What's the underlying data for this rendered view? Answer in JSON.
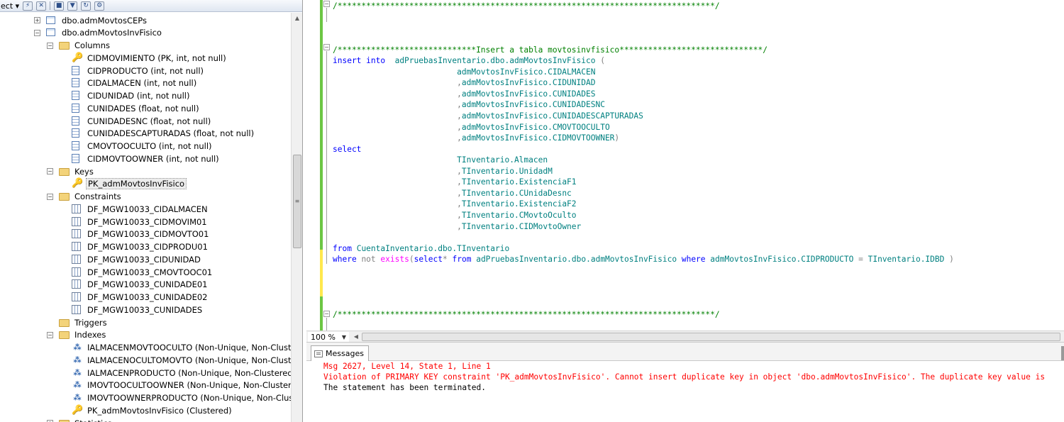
{
  "explorer": {
    "toolbar_label": "ect",
    "tree": [
      {
        "indent": 0,
        "expander": "+",
        "icon": "table",
        "label": "dbo.admMovtosCEPs"
      },
      {
        "indent": 0,
        "expander": "-",
        "icon": "table",
        "label": "dbo.admMovtosInvFisico"
      },
      {
        "indent": 1,
        "expander": "-",
        "icon": "folder",
        "label": "Columns"
      },
      {
        "indent": 2,
        "expander": "",
        "icon": "key",
        "label": "CIDMOVIMIENTO (PK, int, not null)"
      },
      {
        "indent": 2,
        "expander": "",
        "icon": "column",
        "label": "CIDPRODUCTO (int, not null)"
      },
      {
        "indent": 2,
        "expander": "",
        "icon": "column",
        "label": "CIDALMACEN (int, not null)"
      },
      {
        "indent": 2,
        "expander": "",
        "icon": "column",
        "label": "CIDUNIDAD (int, not null)"
      },
      {
        "indent": 2,
        "expander": "",
        "icon": "column",
        "label": "CUNIDADES (float, not null)"
      },
      {
        "indent": 2,
        "expander": "",
        "icon": "column",
        "label": "CUNIDADESNC (float, not null)"
      },
      {
        "indent": 2,
        "expander": "",
        "icon": "column",
        "label": "CUNIDADESCAPTURADAS (float, not null)"
      },
      {
        "indent": 2,
        "expander": "",
        "icon": "column",
        "label": "CMOVTOOCULTO (int, not null)"
      },
      {
        "indent": 2,
        "expander": "",
        "icon": "column",
        "label": "CIDMOVTOOWNER (int, not null)"
      },
      {
        "indent": 1,
        "expander": "-",
        "icon": "folder",
        "label": "Keys"
      },
      {
        "indent": 2,
        "expander": "",
        "icon": "key",
        "label": "PK_admMovtosInvFisico",
        "selected": true
      },
      {
        "indent": 1,
        "expander": "-",
        "icon": "folder",
        "label": "Constraints"
      },
      {
        "indent": 2,
        "expander": "",
        "icon": "constraint",
        "label": "DF_MGW10033_CIDALMACEN"
      },
      {
        "indent": 2,
        "expander": "",
        "icon": "constraint",
        "label": "DF_MGW10033_CIDMOVIM01"
      },
      {
        "indent": 2,
        "expander": "",
        "icon": "constraint",
        "label": "DF_MGW10033_CIDMOVTO01"
      },
      {
        "indent": 2,
        "expander": "",
        "icon": "constraint",
        "label": "DF_MGW10033_CIDPRODU01"
      },
      {
        "indent": 2,
        "expander": "",
        "icon": "constraint",
        "label": "DF_MGW10033_CIDUNIDAD"
      },
      {
        "indent": 2,
        "expander": "",
        "icon": "constraint",
        "label": "DF_MGW10033_CMOVTOOC01"
      },
      {
        "indent": 2,
        "expander": "",
        "icon": "constraint",
        "label": "DF_MGW10033_CUNIDADE01"
      },
      {
        "indent": 2,
        "expander": "",
        "icon": "constraint",
        "label": "DF_MGW10033_CUNIDADE02"
      },
      {
        "indent": 2,
        "expander": "",
        "icon": "constraint",
        "label": "DF_MGW10033_CUNIDADES"
      },
      {
        "indent": 1,
        "expander": "",
        "icon": "folder",
        "label": "Triggers"
      },
      {
        "indent": 1,
        "expander": "-",
        "icon": "folder",
        "label": "Indexes"
      },
      {
        "indent": 2,
        "expander": "",
        "icon": "index",
        "label": "IALMACENMOVTOOCULTO (Non-Unique, Non-Cluster"
      },
      {
        "indent": 2,
        "expander": "",
        "icon": "index",
        "label": "IALMACENOCULTOMOVTO (Non-Unique, Non-Cluster"
      },
      {
        "indent": 2,
        "expander": "",
        "icon": "index",
        "label": "IALMACENPRODUCTO (Non-Unique, Non-Clustered)"
      },
      {
        "indent": 2,
        "expander": "",
        "icon": "index",
        "label": "IMOVTOOCULTOOWNER (Non-Unique, Non-Clustered"
      },
      {
        "indent": 2,
        "expander": "",
        "icon": "index",
        "label": "IMOVTOOWNERPRODUCTO (Non-Unique, Non-Cluster"
      },
      {
        "indent": 2,
        "expander": "",
        "icon": "key",
        "label": "PK_admMovtosInvFisico (Clustered)"
      },
      {
        "indent": 1,
        "expander": "+",
        "icon": "folder",
        "label": "Statistics"
      }
    ]
  },
  "editor": {
    "zoom": "100 %",
    "lines": [
      {
        "line": 0,
        "segments": [
          {
            "c": "cm",
            "t": "/*******************************************************************************/"
          }
        ]
      },
      {
        "line": 4,
        "segments": [
          {
            "c": "cm",
            "t": "/*****************************Insert a tabla movtosinvfisico******************************/"
          }
        ]
      },
      {
        "line": 5,
        "segments": [
          {
            "c": "kw",
            "t": "insert into"
          },
          {
            "c": "",
            "t": "  "
          },
          {
            "c": "id",
            "t": "adPruebasInventario.dbo.admMovtosInvFisico"
          },
          {
            "c": "gray",
            "t": " ("
          }
        ]
      },
      {
        "line": 6,
        "segments": [
          {
            "c": "",
            "t": "                          "
          },
          {
            "c": "id",
            "t": "admMovtosInvFisico.CIDALMACEN"
          }
        ]
      },
      {
        "line": 7,
        "segments": [
          {
            "c": "",
            "t": "                          "
          },
          {
            "c": "gray",
            "t": ","
          },
          {
            "c": "id",
            "t": "admMovtosInvFisico.CIDUNIDAD"
          }
        ]
      },
      {
        "line": 8,
        "segments": [
          {
            "c": "",
            "t": "                          "
          },
          {
            "c": "gray",
            "t": ","
          },
          {
            "c": "id",
            "t": "admMovtosInvFisico.CUNIDADES"
          }
        ]
      },
      {
        "line": 9,
        "segments": [
          {
            "c": "",
            "t": "                          "
          },
          {
            "c": "gray",
            "t": ","
          },
          {
            "c": "id",
            "t": "admMovtosInvFisico.CUNIDADESNC"
          }
        ]
      },
      {
        "line": 10,
        "segments": [
          {
            "c": "",
            "t": "                          "
          },
          {
            "c": "gray",
            "t": ","
          },
          {
            "c": "id",
            "t": "admMovtosInvFisico.CUNIDADESCAPTURADAS"
          }
        ]
      },
      {
        "line": 11,
        "segments": [
          {
            "c": "",
            "t": "                          "
          },
          {
            "c": "gray",
            "t": ","
          },
          {
            "c": "id",
            "t": "admMovtosInvFisico.CMOVTOOCULTO"
          }
        ]
      },
      {
        "line": 12,
        "segments": [
          {
            "c": "",
            "t": "                          "
          },
          {
            "c": "gray",
            "t": ","
          },
          {
            "c": "id",
            "t": "admMovtosInvFisico.CIDMOVTOOWNER"
          },
          {
            "c": "gray",
            "t": ")"
          }
        ]
      },
      {
        "line": 13,
        "segments": [
          {
            "c": "kw",
            "t": "select"
          }
        ]
      },
      {
        "line": 14,
        "segments": [
          {
            "c": "",
            "t": "                          "
          },
          {
            "c": "id",
            "t": "TInventario.Almacen"
          }
        ]
      },
      {
        "line": 15,
        "segments": [
          {
            "c": "",
            "t": "                          "
          },
          {
            "c": "gray",
            "t": ","
          },
          {
            "c": "id",
            "t": "TInventario.UnidadM"
          }
        ]
      },
      {
        "line": 16,
        "segments": [
          {
            "c": "",
            "t": "                          "
          },
          {
            "c": "gray",
            "t": ","
          },
          {
            "c": "id",
            "t": "TInventario.ExistenciaF1"
          }
        ]
      },
      {
        "line": 17,
        "segments": [
          {
            "c": "",
            "t": "                          "
          },
          {
            "c": "gray",
            "t": ","
          },
          {
            "c": "id",
            "t": "TInventario.CUnidaDesnc"
          }
        ]
      },
      {
        "line": 18,
        "segments": [
          {
            "c": "",
            "t": "                          "
          },
          {
            "c": "gray",
            "t": ","
          },
          {
            "c": "id",
            "t": "TInventario.ExistenciaF2"
          }
        ]
      },
      {
        "line": 19,
        "segments": [
          {
            "c": "",
            "t": "                          "
          },
          {
            "c": "gray",
            "t": ","
          },
          {
            "c": "id",
            "t": "TInventario.CMovtoOculto"
          }
        ]
      },
      {
        "line": 20,
        "segments": [
          {
            "c": "",
            "t": "                          "
          },
          {
            "c": "gray",
            "t": ","
          },
          {
            "c": "id",
            "t": "TInventario.CIDMovtoOwner"
          }
        ]
      },
      {
        "line": 22,
        "segments": [
          {
            "c": "kw",
            "t": "from"
          },
          {
            "c": "",
            "t": " "
          },
          {
            "c": "id",
            "t": "CuentaInventario.dbo.TInventario"
          }
        ]
      },
      {
        "line": 23,
        "segments": [
          {
            "c": "kw",
            "t": "where"
          },
          {
            "c": "",
            "t": " "
          },
          {
            "c": "gray",
            "t": "not"
          },
          {
            "c": "",
            "t": " "
          },
          {
            "c": "pink",
            "t": "exists"
          },
          {
            "c": "gray",
            "t": "("
          },
          {
            "c": "kw",
            "t": "select"
          },
          {
            "c": "gray",
            "t": "*"
          },
          {
            "c": "",
            "t": " "
          },
          {
            "c": "kw",
            "t": "from"
          },
          {
            "c": "",
            "t": " "
          },
          {
            "c": "id",
            "t": "adPruebasInventario.dbo.admMovtosInvFisico"
          },
          {
            "c": "",
            "t": " "
          },
          {
            "c": "kw",
            "t": "where"
          },
          {
            "c": "",
            "t": " "
          },
          {
            "c": "id",
            "t": "admMovtosInvFisico.CIDPRODUCTO"
          },
          {
            "c": "",
            "t": " "
          },
          {
            "c": "gray",
            "t": "="
          },
          {
            "c": "",
            "t": " "
          },
          {
            "c": "id",
            "t": "TInventario.IDBD"
          },
          {
            "c": "",
            "t": " "
          },
          {
            "c": "gray",
            "t": ")"
          }
        ]
      },
      {
        "line": 28,
        "segments": [
          {
            "c": "cm",
            "t": "/*******************************************************************************/"
          }
        ]
      }
    ]
  },
  "results": {
    "tab_label": "Messages",
    "lines": [
      {
        "cls": "err",
        "t": "Msg 2627, Level 14, State 1, Line 1"
      },
      {
        "cls": "err",
        "t": "Violation of PRIMARY KEY constraint 'PK_admMovtosInvFisico'. Cannot insert duplicate key in object 'dbo.admMovtosInvFisico'. The duplicate key value is"
      },
      {
        "cls": "",
        "t": "The statement has been terminated."
      }
    ]
  },
  "colors": {
    "keyword": "#0000ff",
    "comment": "#008000",
    "identifier": "#008080",
    "operator": "#808080",
    "function": "#ff00ff",
    "error": "#ff0000",
    "saved_change_bar": "#6cc644",
    "unsaved_change_bar": "#ffe84d"
  }
}
